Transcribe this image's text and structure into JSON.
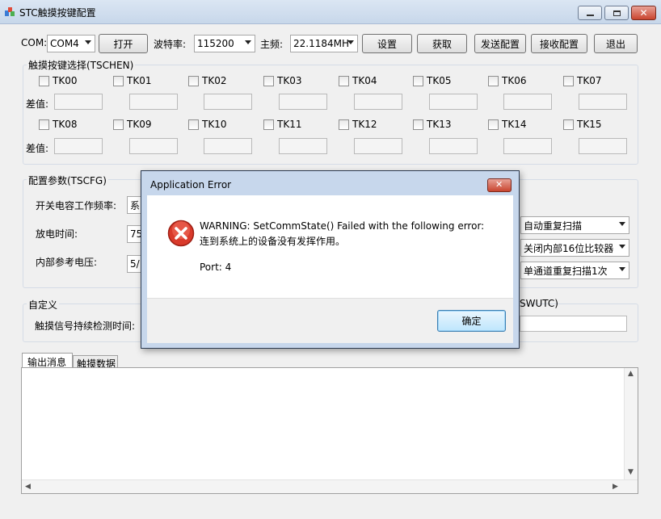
{
  "window": {
    "title": "STC触摸按键配置"
  },
  "toolbar": {
    "com_label": "COM:",
    "com_value": "COM4",
    "open_button": "打开",
    "baud_label": "波特率:",
    "baud_value": "115200",
    "freq_label": "主频:",
    "freq_value": "22.1184MH",
    "set_button": "设置",
    "get_button": "获取",
    "send_button": "发送配置",
    "receive_button": "接收配置",
    "exit_button": "退出"
  },
  "tschen": {
    "title": "触摸按键选择(TSCHEN)",
    "diff_label": "差值:",
    "row1": [
      "TK00",
      "TK01",
      "TK02",
      "TK03",
      "TK04",
      "TK05",
      "TK06",
      "TK07"
    ],
    "row2": [
      "TK08",
      "TK09",
      "TK10",
      "TK11",
      "TK12",
      "TK13",
      "TK14",
      "TK15"
    ]
  },
  "tscfg": {
    "title": "配置参数(TSCFG)",
    "switch_freq_label": "开关电容工作频率:",
    "switch_freq_value": "系",
    "discharge_label": "放电时间:",
    "discharge_value": "75",
    "ref_voltage_label": "内部参考电压:",
    "ref_voltage_value": "5/",
    "scan_mode_value": "自动重复扫描",
    "comparator_value": "关闭内部16位比较器",
    "channel_scan_value": "单通道重复扫描1次"
  },
  "custom": {
    "title": "自定义",
    "continuous_label": "触摸信号持续检测时间:",
    "right_label_fragment": "SWUTC)"
  },
  "tabs": {
    "output": "输出消息",
    "touch_data": "触摸数据"
  },
  "dialog": {
    "title": "Application Error",
    "message_line1": "WARNING:  SetCommState() Failed with the following error:",
    "message_line2": "连到系统上的设备没有发挥作用。",
    "port_line": "Port: 4",
    "ok_button": "确定"
  },
  "colors": {
    "error_red": "#d93a2b",
    "titlebar": "#c7d7ea"
  }
}
